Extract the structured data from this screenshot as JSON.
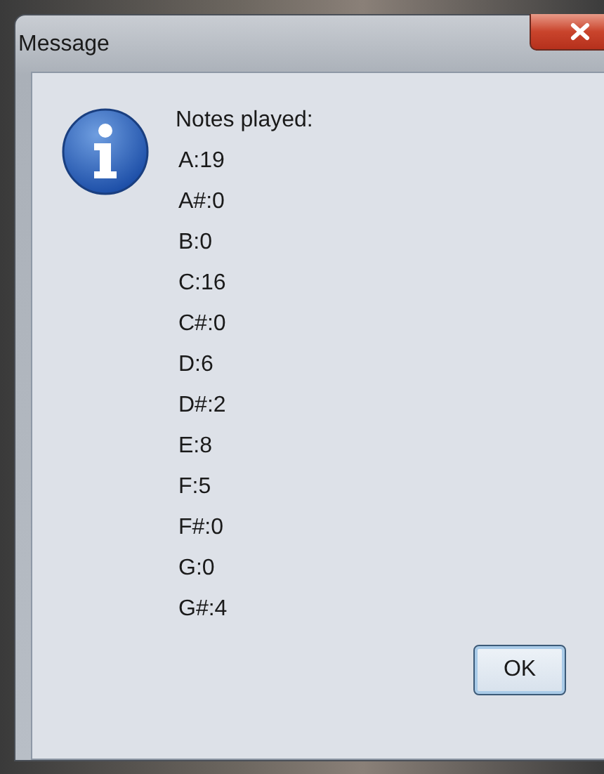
{
  "window": {
    "title": "Message"
  },
  "message": {
    "heading": "Notes played:",
    "lines": [
      "A:19",
      "A#:0",
      "B:0",
      "C:16",
      "C#:0",
      "D:6",
      "D#:2",
      "E:8",
      "F:5",
      "F#:0",
      "G:0",
      "G#:4"
    ]
  },
  "buttons": [
    "OK"
  ]
}
